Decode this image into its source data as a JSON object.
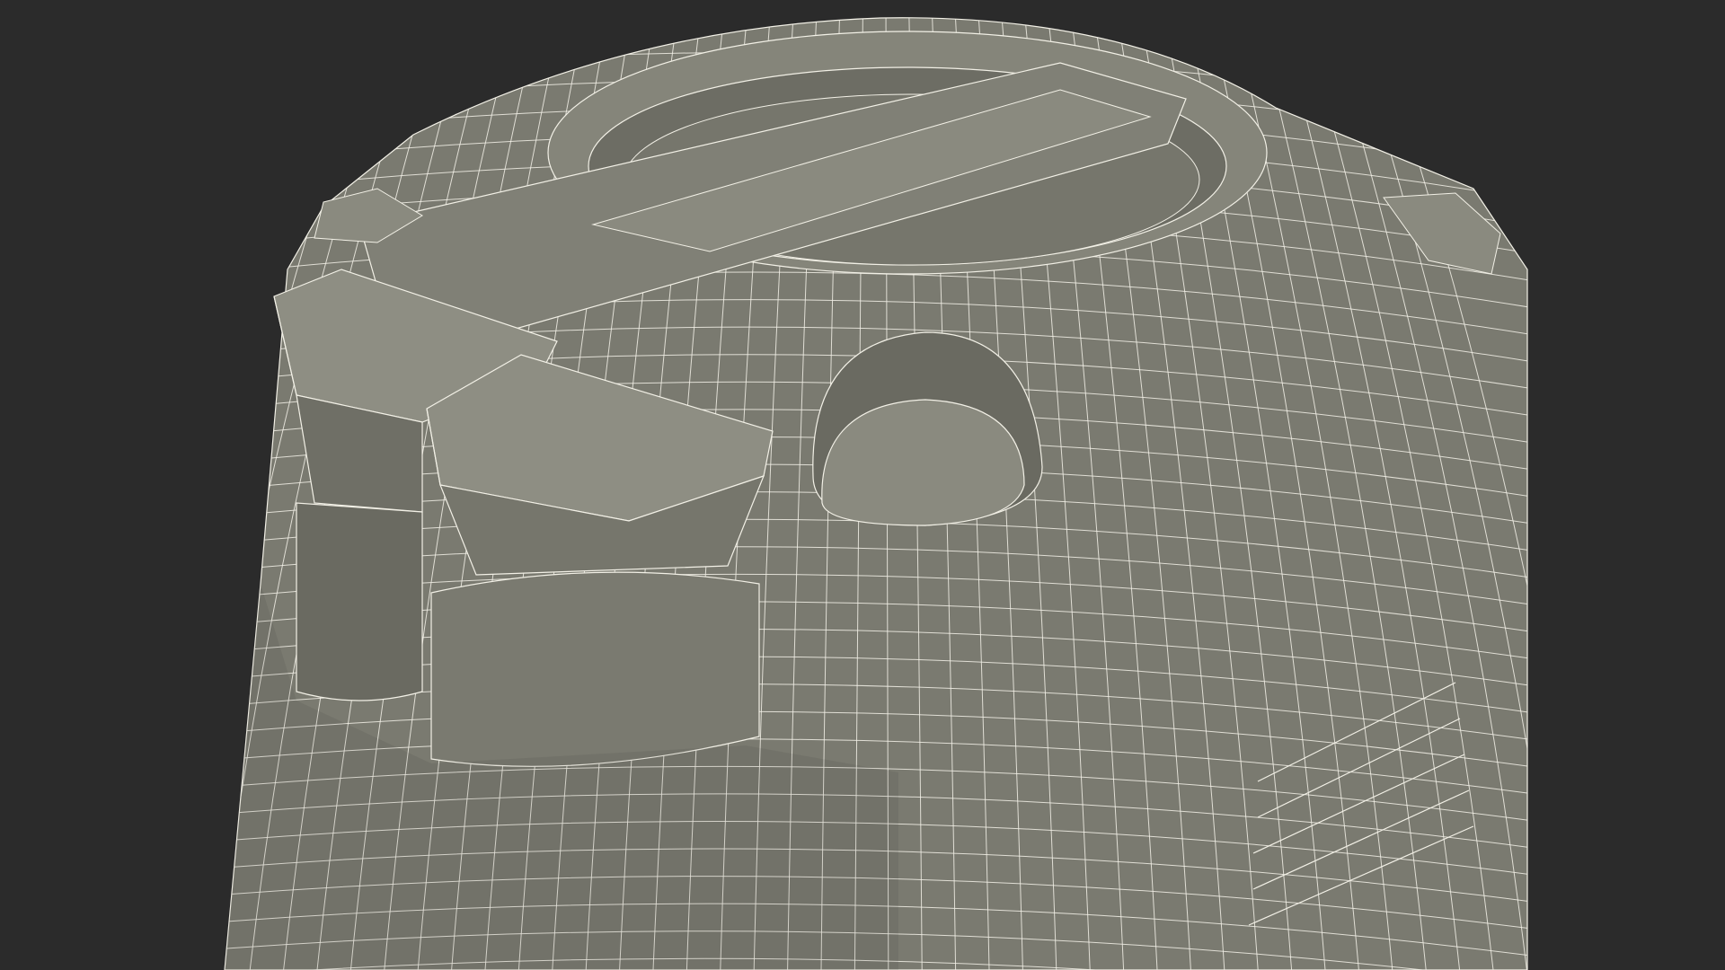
{
  "scene": {
    "background_color": "#2b2b2b",
    "mesh_fill_color": "#7a7a70",
    "mesh_shadow_color": "#5f5f57",
    "mesh_highlight_color": "#8e8e83",
    "wire_color": "#f2f0e6",
    "subject": "wireframe-3d-render-canister"
  }
}
